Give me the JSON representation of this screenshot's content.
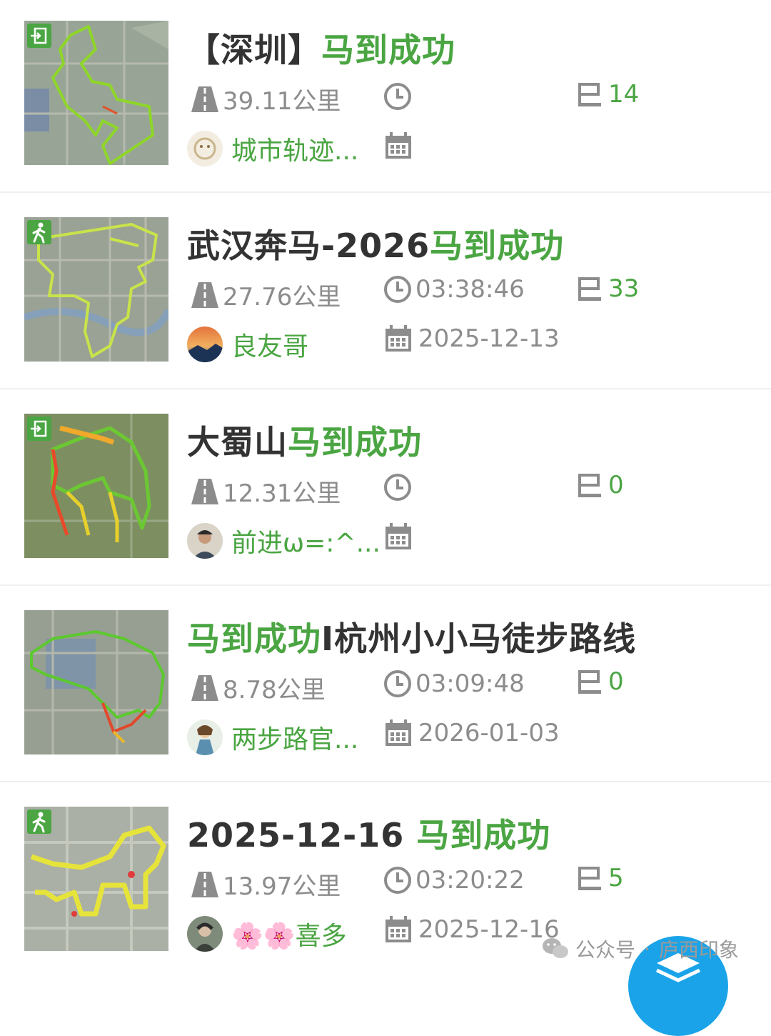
{
  "routes": [
    {
      "title_prefix": "【深圳】",
      "title_highlight": "马到成功",
      "title_suffix": "",
      "badge_icon": "enter-icon",
      "distance": "39.11公里",
      "duration": "",
      "checkpoints": "14",
      "author": "城市轨迹...",
      "date": ""
    },
    {
      "title_prefix": "武汉奔马-2026",
      "title_highlight": "马到成功",
      "title_suffix": "",
      "badge_icon": "walking-icon",
      "distance": "27.76公里",
      "duration": "03:38:46",
      "checkpoints": "33",
      "author": "良友哥",
      "date": "2025-12-13"
    },
    {
      "title_prefix": "大蜀山",
      "title_highlight": "马到成功",
      "title_suffix": "",
      "badge_icon": "enter-icon",
      "distance": "12.31公里",
      "duration": "",
      "checkpoints": "0",
      "author": "前进ω=:^...",
      "date": ""
    },
    {
      "title_prefix": "",
      "title_highlight": "马到成功",
      "title_suffix": "I杭州小小马徒步路线",
      "badge_icon": "",
      "distance": "8.78公里",
      "duration": "03:09:48",
      "checkpoints": "0",
      "author": "两步路官...",
      "date": "2026-01-03"
    },
    {
      "title_prefix": "2025-12-16 ",
      "title_highlight": "马到成功",
      "title_suffix": "",
      "badge_icon": "walking-icon",
      "distance": "13.97公里",
      "duration": "03:20:22",
      "checkpoints": "5",
      "author": "🌸🌸喜多",
      "date": "2025-12-16"
    }
  ],
  "watermark": {
    "label": "公众号",
    "separator": "·",
    "name": "庐西印象"
  },
  "colors": {
    "accent": "#4aa542",
    "muted": "#8c8c8c",
    "title": "#333333",
    "fab": "#1aa3e8"
  }
}
